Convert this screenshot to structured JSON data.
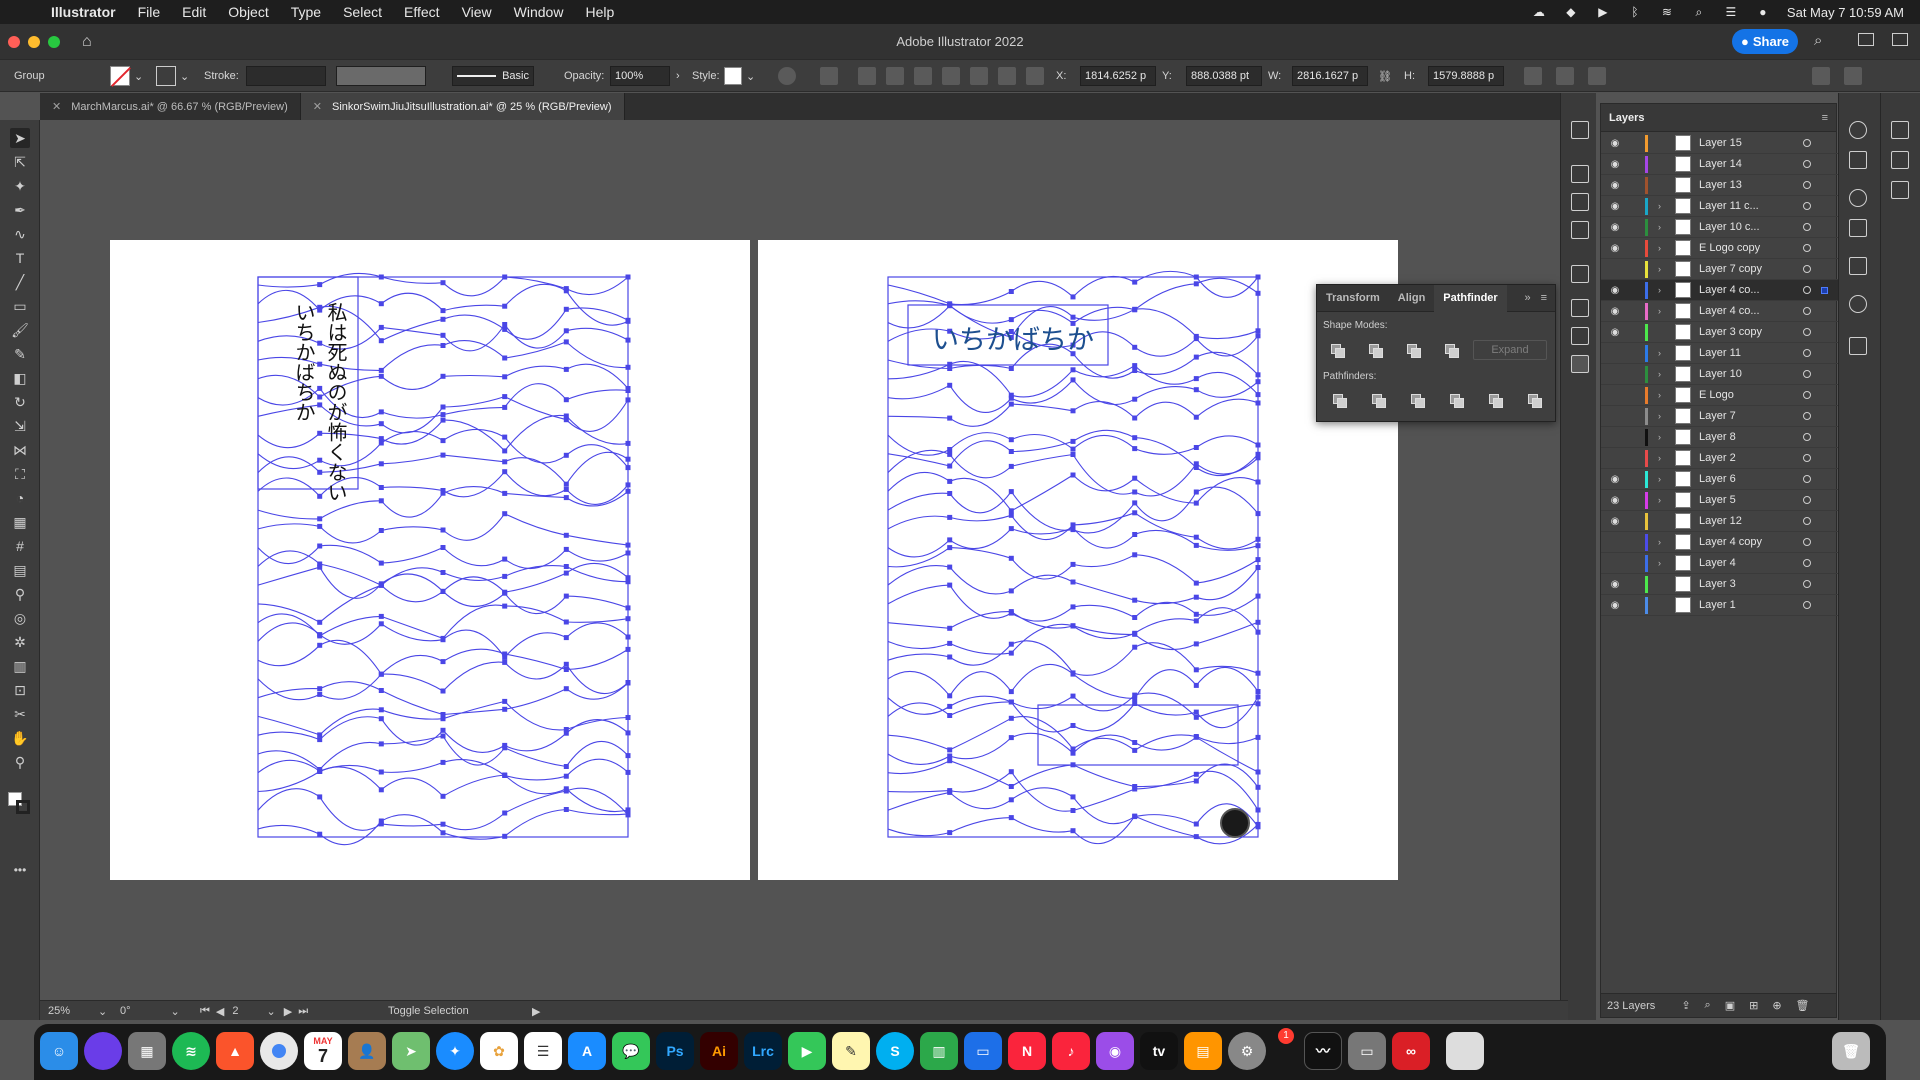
{
  "menubar": {
    "app": "Illustrator",
    "items": [
      "File",
      "Edit",
      "Object",
      "Type",
      "Select",
      "Effect",
      "View",
      "Window",
      "Help"
    ],
    "clock": "Sat May 7  10:59 AM"
  },
  "titlebar": {
    "title": "Adobe Illustrator 2022",
    "share": "Share"
  },
  "controlbar": {
    "selection": "Group",
    "stroke_label": "Stroke:",
    "brush": "Basic",
    "opacity_label": "Opacity:",
    "opacity": "100%",
    "style_label": "Style:",
    "x_label": "X:",
    "x": "1814.6252 p",
    "y_label": "Y:",
    "y": "888.0388 pt",
    "w_label": "W:",
    "w": "2816.1627 p",
    "h_label": "H:",
    "h": "1579.8888 p"
  },
  "tabs": [
    {
      "label": "MarchMarcus.ai* @ 66.67 % (RGB/Preview)",
      "active": false
    },
    {
      "label": "SinkorSwimJiuJitsuIllustration.ai* @ 25 % (RGB/Preview)",
      "active": true
    }
  ],
  "artboards": {
    "left_text_1": "私は死ぬのが怖くない",
    "left_text_2": "いちかばちか",
    "right_text": "いちかばちか",
    "path_color": "#4a46e6"
  },
  "pathfinder": {
    "tabs": [
      "Transform",
      "Align",
      "Pathfinder"
    ],
    "shape_modes_label": "Shape Modes:",
    "pathfinders_label": "Pathfinders:",
    "expand": "Expand"
  },
  "layers": {
    "title": "Layers",
    "count": "23 Layers",
    "rows": [
      {
        "name": "Layer 15",
        "color": "#f29b2f",
        "eye": true,
        "arrow": false
      },
      {
        "name": "Layer 14",
        "color": "#a546e6",
        "eye": true,
        "arrow": false
      },
      {
        "name": "Layer 13",
        "color": "#a0522d",
        "eye": true,
        "arrow": false
      },
      {
        "name": "Layer 11 c...",
        "color": "#1aa7c7",
        "eye": true,
        "arrow": true
      },
      {
        "name": "Layer 10 c...",
        "color": "#2c8f3e",
        "eye": true,
        "arrow": true
      },
      {
        "name": "E Logo copy",
        "color": "#e84b3c",
        "eye": true,
        "arrow": true
      },
      {
        "name": "Layer 7 copy",
        "color": "#e8e23c",
        "eye": false,
        "arrow": true
      },
      {
        "name": "Layer 4 co...",
        "color": "#3c6ee8",
        "eye": true,
        "arrow": true,
        "selected": true
      },
      {
        "name": "Layer 4 co...",
        "color": "#e86bc7",
        "eye": true,
        "arrow": true
      },
      {
        "name": "Layer 3 copy",
        "color": "#4ce84c",
        "eye": true,
        "arrow": false
      },
      {
        "name": "Layer 11",
        "color": "#2c7be8",
        "eye": false,
        "arrow": true
      },
      {
        "name": "Layer 10",
        "color": "#2c8f3e",
        "eye": false,
        "arrow": true
      },
      {
        "name": "E Logo",
        "color": "#e87c2c",
        "eye": false,
        "arrow": true
      },
      {
        "name": "Layer 7",
        "color": "#8c8c8c",
        "eye": false,
        "arrow": true
      },
      {
        "name": "Layer 8",
        "color": "#111111",
        "eye": false,
        "arrow": true
      },
      {
        "name": "Layer 2",
        "color": "#e84b4b",
        "eye": false,
        "arrow": true
      },
      {
        "name": "Layer 6",
        "color": "#2ce8d6",
        "eye": true,
        "arrow": true
      },
      {
        "name": "Layer 5",
        "color": "#d63ce8",
        "eye": true,
        "arrow": true
      },
      {
        "name": "Layer 12",
        "color": "#e8c23c",
        "eye": true,
        "arrow": false
      },
      {
        "name": "Layer 4 copy",
        "color": "#4c4ce8",
        "eye": false,
        "arrow": true
      },
      {
        "name": "Layer 4",
        "color": "#3c6ee8",
        "eye": false,
        "arrow": true
      },
      {
        "name": "Layer 3",
        "color": "#4ce84c",
        "eye": true,
        "arrow": false
      },
      {
        "name": "Layer 1",
        "color": "#4c8ce8",
        "eye": true,
        "arrow": false
      }
    ]
  },
  "statusbar": {
    "zoom": "25%",
    "rotation": "0°",
    "artboard": "2",
    "mode": "Toggle Selection"
  },
  "dock": {
    "apps": [
      "Finder",
      "Siri",
      "Launchpad",
      "Spotify",
      "Brave",
      "Chrome",
      "Calendar",
      "Contacts",
      "Maps",
      "Safari",
      "Photos",
      "Reminders",
      "App Store",
      "Messages",
      "Photoshop",
      "Illustrator",
      "Lightroom Classic",
      "FaceTime",
      "Notes",
      "Skype",
      "Numbers",
      "Keynote",
      "News",
      "Music",
      "Podcasts",
      "TV",
      "Books",
      "System Preferences"
    ],
    "calendar_month": "MAY",
    "calendar_day": "7",
    "ps": "Ps",
    "ai": "Ai",
    "lrc": "Lrc",
    "badge": "1"
  }
}
